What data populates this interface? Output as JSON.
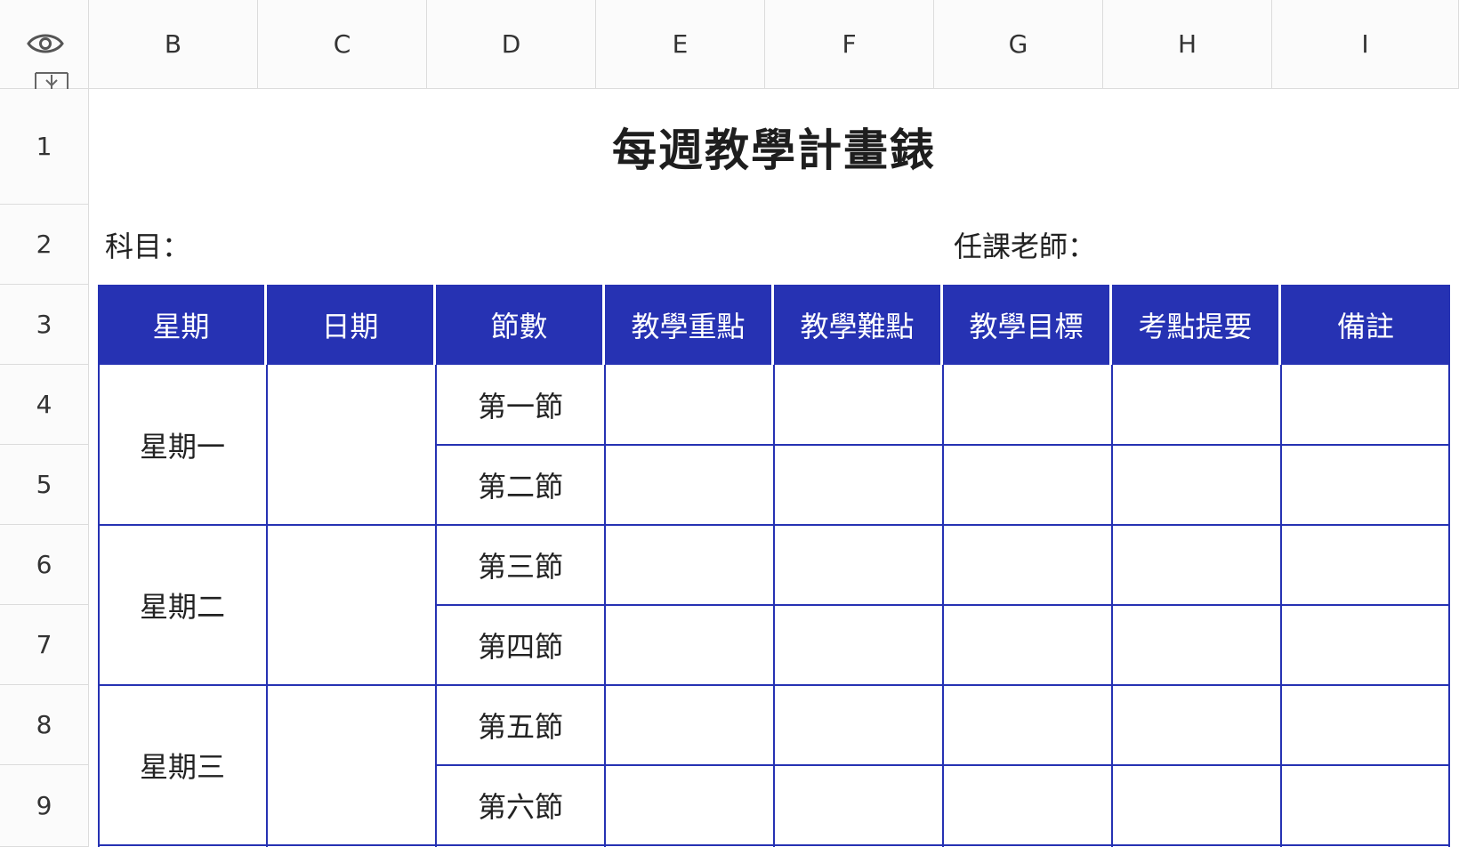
{
  "toolbar": {
    "visibility_icon": "eye-icon",
    "freeze_icon": "freeze-rows-icon"
  },
  "columns": [
    "B",
    "C",
    "D",
    "E",
    "F",
    "G",
    "H",
    "I"
  ],
  "rows": [
    "1",
    "2",
    "3",
    "4",
    "5",
    "6",
    "7",
    "8",
    "9"
  ],
  "sheet": {
    "title": "每週教學計畫錶",
    "subject_label": "科目：",
    "teacher_label": "任課老師："
  },
  "table": {
    "headers": [
      "星期",
      "日期",
      "節數",
      "教學重點",
      "教學難點",
      "教學目標",
      "考點提要",
      "備註"
    ],
    "days": [
      "星期一",
      "星期二",
      "星期三"
    ],
    "periods": [
      "第一節",
      "第二節",
      "第三節",
      "第四節",
      "第五節",
      "第六節"
    ]
  },
  "colors": {
    "header_bg": "#2632b3",
    "header_text": "#ffffff",
    "grid_line": "#2632b3"
  }
}
